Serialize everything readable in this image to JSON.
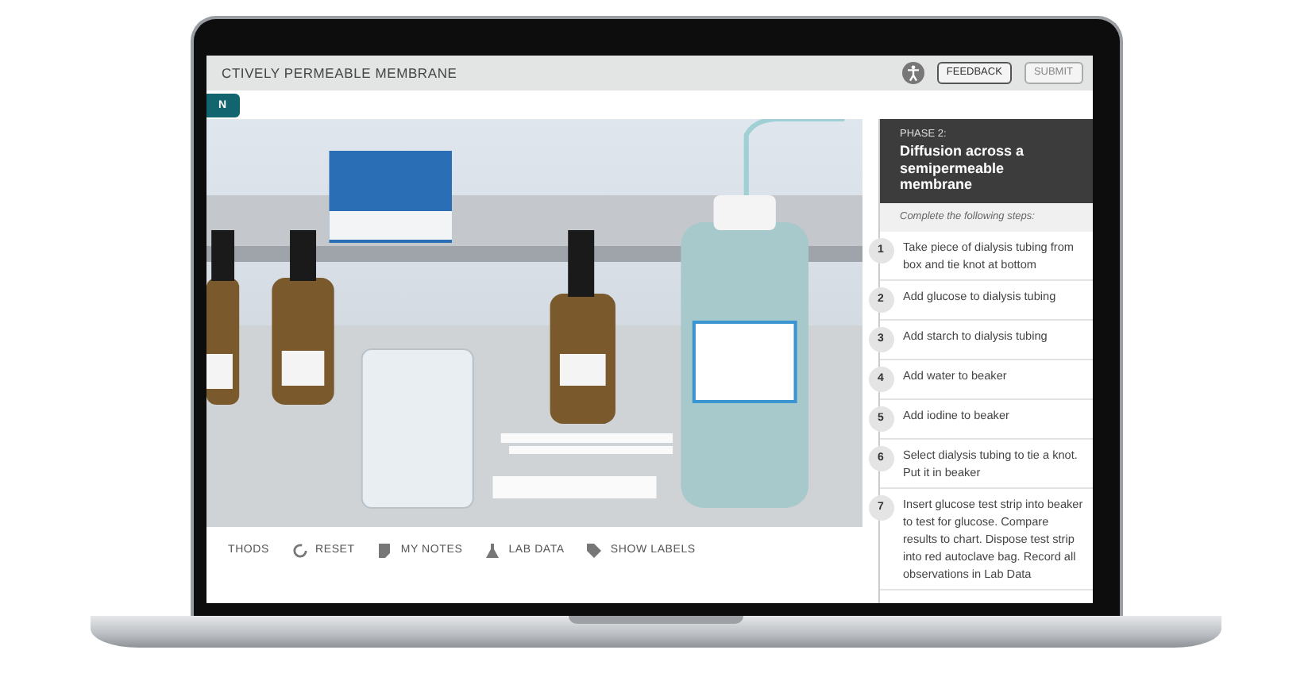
{
  "app": {
    "title": "CTIVELY PERMEABLE MEMBRANE",
    "buttons": [
      {
        "label": "FEEDBACK",
        "disabled": false
      },
      {
        "label": "SUBMIT",
        "disabled": true
      }
    ],
    "tab_button": "N"
  },
  "phase": {
    "label": "PHASE 2:",
    "title": "Diffusion across a semipermeable membrane",
    "instruction": "Complete the following steps:"
  },
  "steps": [
    {
      "number": "1",
      "text": "Take piece of dialysis tubing from box and tie knot at bottom"
    },
    {
      "number": "2",
      "text": "Add glucose to dialysis tubing"
    },
    {
      "number": "3",
      "text": "Add starch to dialysis tubing"
    },
    {
      "number": "4",
      "text": "Add water to beaker"
    },
    {
      "number": "5",
      "text": "Add iodine to beaker"
    },
    {
      "number": "6",
      "text": "Select dialysis tubing to tie a knot. Put it in beaker"
    },
    {
      "number": "7",
      "text": "Insert glucose test strip into beaker to test for glucose. Compare results to chart. Dispose test strip into red autoclave bag. Record all observations in Lab Data"
    }
  ],
  "toolbar": [
    {
      "kind": "text",
      "label": "THODS"
    },
    {
      "kind": "reset",
      "label": "RESET"
    },
    {
      "kind": "notes",
      "label": "MY NOTES"
    },
    {
      "kind": "flask",
      "label": "LAB DATA"
    },
    {
      "kind": "tag",
      "label": "SHOW LABELS"
    }
  ]
}
